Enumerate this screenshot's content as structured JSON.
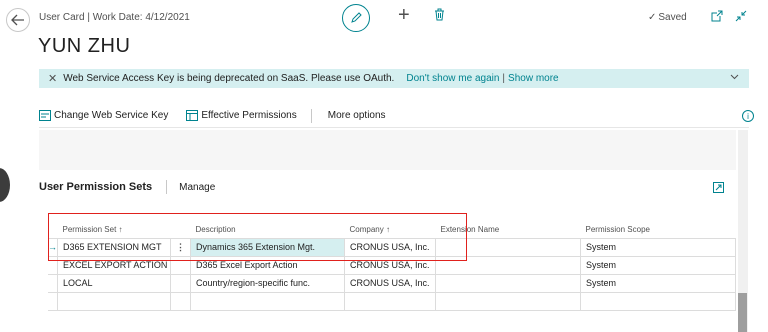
{
  "header": {
    "caption": "User Card | Work Date: 4/12/2021",
    "title": "YUN ZHU",
    "status": "Saved"
  },
  "notification": {
    "message": "Web Service Access Key is being deprecated on SaaS. Please use OAuth.",
    "dont_show": "Don't show me again",
    "separator": "|",
    "show_more": "Show more"
  },
  "actions": {
    "change_key": "Change Web Service Key",
    "effective_permissions": "Effective Permissions",
    "more_options": "More options"
  },
  "part": {
    "title": "User Permission Sets",
    "manage": "Manage",
    "columns": {
      "permission_set": "Permission Set ↑",
      "description": "Description",
      "company": "Company ↑",
      "extension_name": "Extension Name",
      "scope": "Permission Scope"
    },
    "rows": [
      {
        "permission_set": "D365 EXTENSION MGT",
        "description": "Dynamics 365 Extension Mgt.",
        "company": "CRONUS USA, Inc.",
        "extension_name": "",
        "scope": "System"
      },
      {
        "permission_set": "EXCEL EXPORT ACTION",
        "description": "D365 Excel Export Action",
        "company": "CRONUS USA, Inc.",
        "extension_name": "",
        "scope": "System"
      },
      {
        "permission_set": "LOCAL",
        "description": "Country/region-specific func.",
        "company": "CRONUS USA, Inc.",
        "extension_name": "",
        "scope": "System"
      },
      {
        "permission_set": "",
        "description": "",
        "company": "",
        "extension_name": "",
        "scope": ""
      }
    ]
  },
  "icons": {
    "back": "back-arrow-icon",
    "edit": "pencil-icon",
    "new": "plus-icon",
    "delete": "trash-icon",
    "saved": "checkmark-icon",
    "popout": "open-new-window-icon",
    "collapse": "collapse-icon",
    "close": "close-icon",
    "chevron": "chevron-down-icon",
    "key": "key-icon",
    "permissions": "permissions-icon",
    "info": "info-icon",
    "expand": "expand-icon",
    "row_marker": "row-arrow-icon"
  },
  "colors": {
    "accent": "#00838f",
    "notification_bg": "#d5eff0",
    "highlight_border": "#e0211d",
    "selected_cell": "#d5eff0"
  }
}
